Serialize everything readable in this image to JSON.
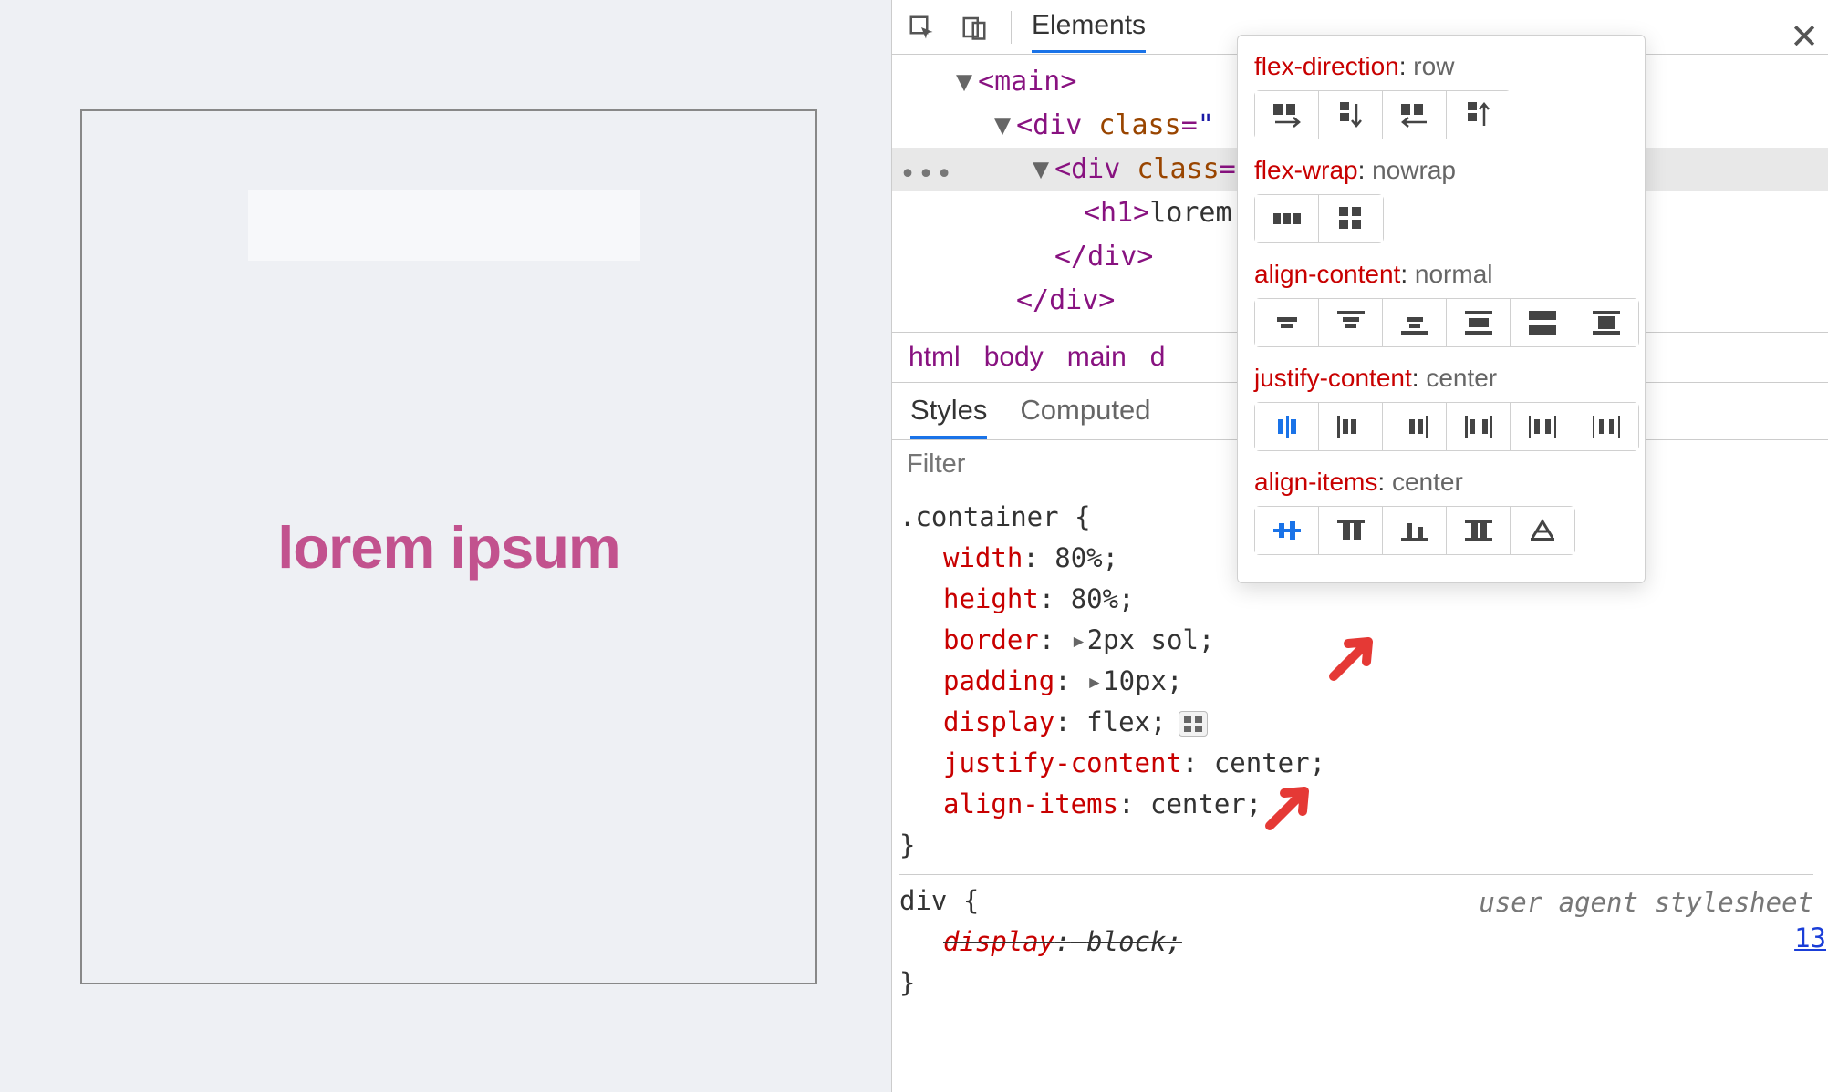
{
  "demo": {
    "heading": "lorem ipsum"
  },
  "devtools": {
    "tabs": {
      "elements": "Elements"
    },
    "dom": {
      "main_open": "<main>",
      "wrap_open_prefix": "<div",
      "wrap_attr": "class",
      "wrap_attr_val_partial": "\"",
      "container_open_prefix": "<div",
      "container_attr": "class",
      "h1_open": "<h1>",
      "h1_text": "lorem",
      "div_close": "</div>",
      "div_close2": "</div>"
    },
    "breadcrumbs": [
      "html",
      "body",
      "main",
      "d"
    ],
    "styles_tabs": {
      "styles": "Styles",
      "computed": "Computed"
    },
    "filter_placeholder": "Filter",
    "link_line": "13",
    "css": {
      "selector": ".container",
      "brace_open": "{",
      "brace_close": "}",
      "rules": [
        {
          "prop": "width",
          "val": "80%"
        },
        {
          "prop": "height",
          "val": "80%"
        },
        {
          "prop": "border",
          "val": "2px sol",
          "expand": true
        },
        {
          "prop": "padding",
          "val": "10px",
          "expand": true
        },
        {
          "prop": "display",
          "val": "flex",
          "flexicon": true
        },
        {
          "prop": "justify-content",
          "val": "center"
        },
        {
          "prop": "align-items",
          "val": "center"
        }
      ],
      "ua_selector": "div",
      "ua_rule_prop": "display",
      "ua_rule_val": "block",
      "ua_label": "user agent stylesheet"
    }
  },
  "popover": {
    "sections": {
      "flex_direction": {
        "prop": "flex-direction",
        "val": "row",
        "options": [
          "row",
          "column",
          "row-reverse",
          "column-reverse"
        ],
        "selected": -1
      },
      "flex_wrap": {
        "prop": "flex-wrap",
        "val": "nowrap",
        "options": [
          "nowrap",
          "wrap"
        ],
        "selected": -1
      },
      "align_content": {
        "prop": "align-content",
        "val": "normal",
        "options": [
          "center",
          "flex-start",
          "flex-end",
          "space-around",
          "space-between",
          "stretch"
        ],
        "selected": -1
      },
      "justify_content": {
        "prop": "justify-content",
        "val": "center",
        "options": [
          "center",
          "flex-start",
          "flex-end",
          "space-between",
          "space-around",
          "space-evenly"
        ],
        "selected": 0
      },
      "align_items": {
        "prop": "align-items",
        "val": "center",
        "options": [
          "center",
          "flex-start",
          "flex-end",
          "stretch",
          "baseline"
        ],
        "selected": 0
      }
    }
  }
}
